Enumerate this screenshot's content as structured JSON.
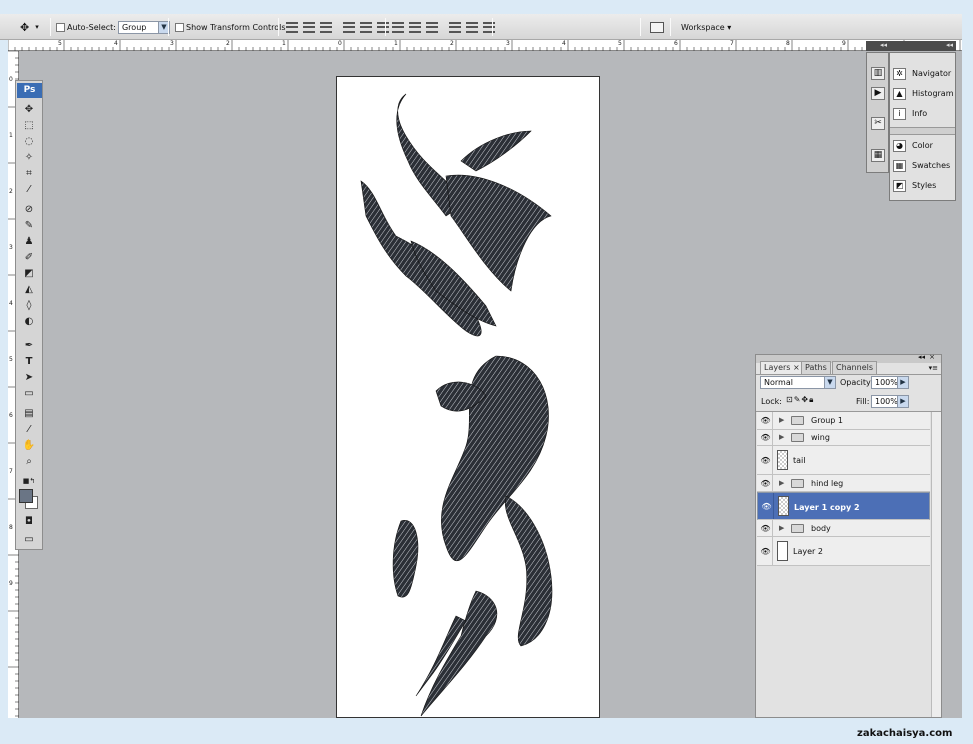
{
  "options_bar": {
    "auto_select_label": "Auto-Select:",
    "auto_select_value": "Group",
    "show_transform_label": "Show Transform Controls",
    "workspace_label": "Workspace ▾"
  },
  "ruler": {
    "h_labels": [
      "5",
      "4",
      "3",
      "2",
      "1",
      "0",
      "1",
      "2",
      "3",
      "4",
      "5",
      "6",
      "7",
      "8",
      "9"
    ],
    "v_labels": [
      "0",
      "1",
      "2",
      "3",
      "4",
      "5",
      "6",
      "7",
      "8",
      "9"
    ]
  },
  "toolbox": {
    "logo": "Ps"
  },
  "dock": {
    "panels": [
      {
        "label": "Navigator",
        "icon": "navigator-icon"
      },
      {
        "label": "Histogram",
        "icon": "histogram-icon"
      },
      {
        "label": "Info",
        "icon": "info-icon"
      },
      {
        "label": "Color",
        "icon": "color-icon"
      },
      {
        "label": "Swatches",
        "icon": "swatches-icon"
      },
      {
        "label": "Styles",
        "icon": "styles-icon"
      }
    ]
  },
  "layers_panel": {
    "tabs": [
      "Layers ×",
      "Paths",
      "Channels"
    ],
    "blend_mode": "Normal",
    "opacity_label": "Opacity:",
    "opacity_value": "100%",
    "lock_label": "Lock:",
    "fill_label": "Fill:",
    "fill_value": "100%",
    "layers": [
      {
        "name": "Group 1",
        "kind": "group",
        "selected": false
      },
      {
        "name": "wing",
        "kind": "group",
        "selected": false
      },
      {
        "name": "tail",
        "kind": "layer",
        "selected": false
      },
      {
        "name": "hind leg",
        "kind": "group",
        "selected": false
      },
      {
        "name": "Layer 1 copy 2",
        "kind": "layer",
        "selected": true
      },
      {
        "name": "body",
        "kind": "group",
        "selected": false
      },
      {
        "name": "Layer 2",
        "kind": "layer",
        "selected": false
      }
    ]
  },
  "colors": {
    "selected_row": "#4c6fb6",
    "canvas_bg": "#b6b8bb"
  },
  "watermark": "zakachaisya.com"
}
